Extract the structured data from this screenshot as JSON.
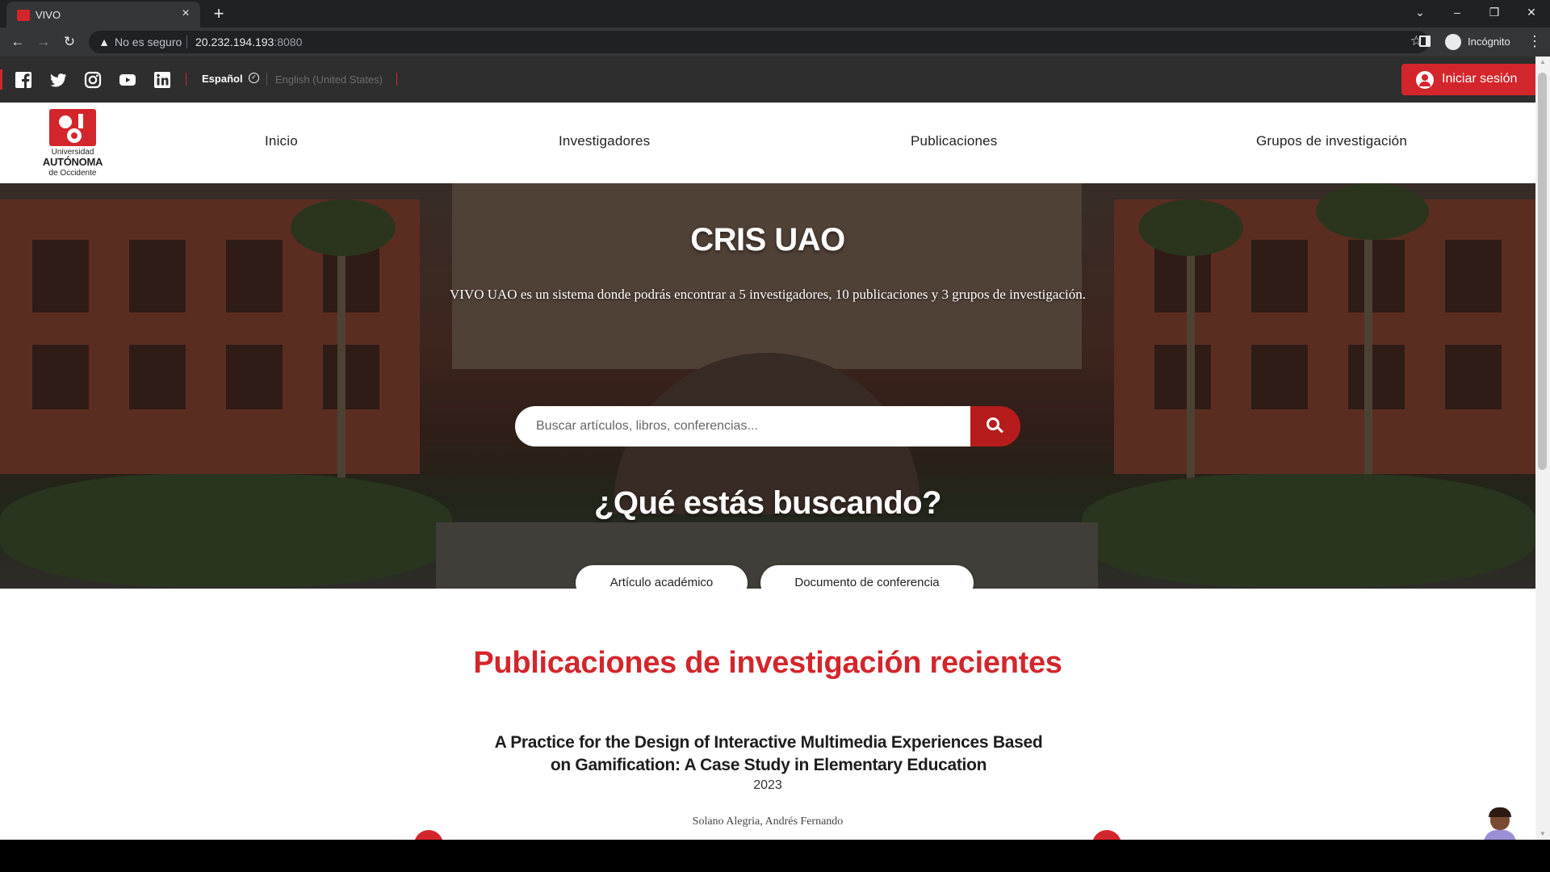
{
  "browser": {
    "tab_title": "VIVO",
    "tab_close": "×",
    "new_tab": "+",
    "security_label": "No es seguro",
    "url_host": "20.232.194.193",
    "url_port": ":8080",
    "profile_label": "Incógnito"
  },
  "topbar": {
    "social": [
      "facebook-icon",
      "twitter-icon",
      "instagram-icon",
      "youtube-icon",
      "linkedin-icon"
    ],
    "lang_active": "Español",
    "lang_other": "English (United States)",
    "login_label": "Iniciar sesión"
  },
  "logo": {
    "line1": "Universidad",
    "line2": "AUTÓNOMA",
    "line3": "de Occidente"
  },
  "nav": {
    "items": [
      "Inicio",
      "Investigadores",
      "Publicaciones",
      "Grupos de investigación"
    ]
  },
  "hero": {
    "title": "CRIS UAO",
    "subtitle": "VIVO UAO es un sistema donde podrás encontrar a 5 investigadores, 10 publicaciones y 3 grupos de investigación.",
    "search_placeholder": "Buscar artículos, libros, conferencias...",
    "question": "¿Qué estás buscando?",
    "chips": [
      "Artículo académico",
      "Documento de conferencia"
    ]
  },
  "recent": {
    "section_title": "Publicaciones de investigación recientes",
    "pub_title": "A Practice for the Design of Interactive Multimedia Experiences Based on Gamification: A Case Study in Elementary Education",
    "pub_year": "2023",
    "pub_author": "Solano Alegria, Andrés Fernando"
  },
  "colors": {
    "brand_red": "#d3262c",
    "topbar_bg": "#2e2e2e"
  }
}
